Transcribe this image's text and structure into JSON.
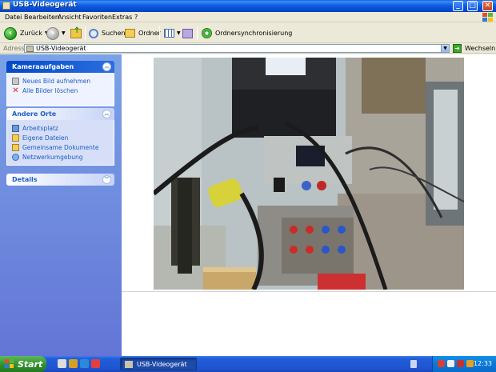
{
  "window": {
    "title": "USB-Videogerät"
  },
  "menu": [
    "Datei",
    "Bearbeiten",
    "Ansicht",
    "Favoriten",
    "Extras",
    "?"
  ],
  "toolbar": {
    "back_label": "Zurück",
    "search_label": "Suchen",
    "folders_label": "Ordner",
    "sync_label": "Ordnersynchronisierung"
  },
  "address": {
    "label": "Adresse",
    "value": "USB-Videogerät",
    "go_label": "Wechseln zu"
  },
  "sidebar": {
    "camera_tasks": {
      "title": "Kameraaufgaben",
      "items": [
        "Neues Bild aufnehmen",
        "Alle Bilder löschen"
      ]
    },
    "other_places": {
      "title": "Andere Orte",
      "items": [
        "Arbeitsplatz",
        "Eigene Dateien",
        "Gemeinsame Dokumente",
        "Netzwerkumgebung"
      ]
    },
    "details": {
      "title": "Details"
    }
  },
  "taskbar": {
    "start_label": "Start",
    "active_window": "USB-Videogerät",
    "clock": "12:33"
  },
  "colors": {
    "title_bar": "#0a5fe6",
    "sidebar_top": "#7ba2e7",
    "sidebar_bottom": "#6375d6",
    "link": "#215dc6",
    "start_green": "#2d8c2a",
    "taskbar_blue": "#245edb"
  }
}
